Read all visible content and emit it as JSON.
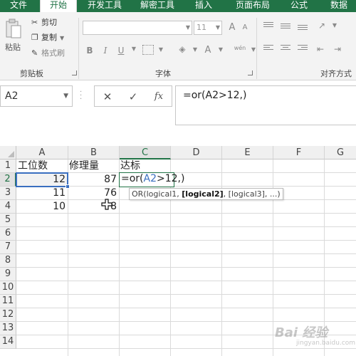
{
  "ribbon": {
    "tabs": [
      {
        "label": "文件"
      },
      {
        "label": "开始"
      },
      {
        "label": "开发工具"
      },
      {
        "label": "解密工具"
      },
      {
        "label": "插入"
      },
      {
        "label": "页面布局"
      },
      {
        "label": "公式"
      },
      {
        "label": "数据"
      }
    ],
    "active_tab": "开始",
    "clipboard": {
      "paste_label": "粘贴",
      "cut_label": "剪切",
      "copy_label": "复制",
      "format_painter_label": "格式刷",
      "group_label": "剪贴板"
    },
    "font": {
      "group_label": "字体",
      "font_name": "",
      "font_size": "11",
      "bold": "B",
      "italic": "I",
      "underline": "U",
      "font_color_label": "A",
      "phonetic_label": "wén"
    },
    "alignment": {
      "group_label": "对齐方式"
    }
  },
  "formula_bar": {
    "name_box": "A2",
    "cancel_symbol": "✕",
    "enter_symbol": "✓",
    "fx_symbol": "fx",
    "formula": "=or(A2>12,)"
  },
  "sheet": {
    "columns": [
      "A",
      "B",
      "C",
      "D",
      "E",
      "F",
      "G"
    ],
    "selected_column": "C",
    "rows": [
      "1",
      "2",
      "3",
      "4",
      "5",
      "6",
      "7",
      "8",
      "9",
      "10",
      "11",
      "12",
      "13",
      "14"
    ],
    "selected_row": "2",
    "cells": {
      "A1": "工位数",
      "B1": "修理量",
      "C1": "达标",
      "A2": "12",
      "B2": "87",
      "A3": "11",
      "B3": "76",
      "A4": "10",
      "B4": "8"
    },
    "editing": {
      "prefix": "=or(",
      "ref": "A2",
      "suffix": ">12,)"
    },
    "hint": {
      "fn": "OR(logical1, ",
      "current": "[logical2]",
      "rest": ", [logical3], ...)"
    }
  },
  "watermark": {
    "brand": "Bai 经验",
    "sub": "jingyan.baidu.com"
  }
}
